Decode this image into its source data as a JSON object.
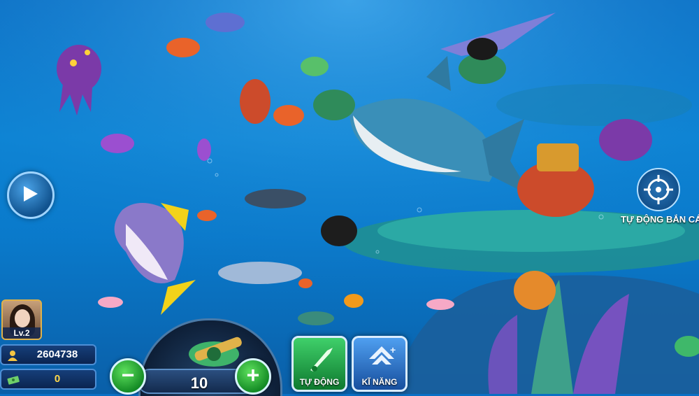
{
  "player": {
    "level": "Lv.2",
    "coins": "2604738",
    "gems": "0"
  },
  "cannon": {
    "bet": "10",
    "minus_symbol": "−",
    "plus_symbol": "+"
  },
  "skills": {
    "auto_label": "TỰ ĐỘNG",
    "ability_label": "KĨ NĂNG"
  },
  "auto_aim": {
    "label": "TỰ ĐỘNG BẮN CÁ"
  },
  "icons": {
    "play": "play-icon",
    "target": "crosshair-icon",
    "user": "user-icon",
    "gem": "cash-icon"
  },
  "colors": {
    "ocean": "#0a7acb",
    "green_button": "#1fa83a",
    "blue_button": "#2a6fc4",
    "gold": "#ffd84a"
  }
}
